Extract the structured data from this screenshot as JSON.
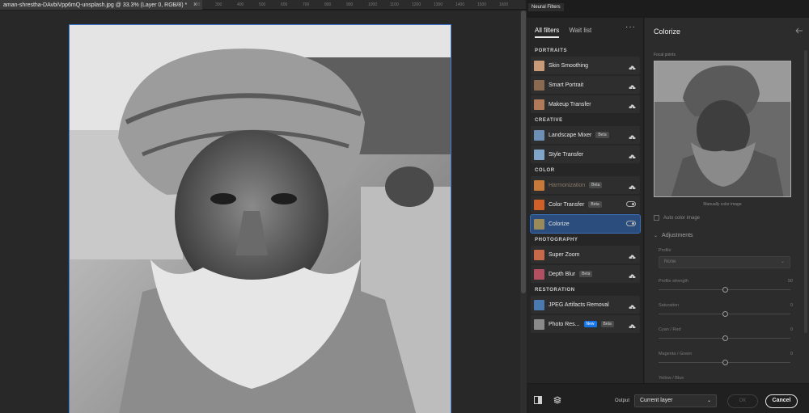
{
  "document": {
    "tab_title": "aman-shrestha-DAvbiVpp6mQ-unsplash.jpg @ 33.3% (Layer 0, RGB/8) *",
    "close_glyph": "×",
    "ruler_marks": [
      "100",
      "200",
      "300",
      "400",
      "500",
      "600",
      "700",
      "800",
      "900",
      "1000",
      "1100",
      "1200",
      "1300",
      "1400",
      "1500",
      "1600"
    ]
  },
  "neural_filters": {
    "window_title": "Neural Filters",
    "tabs": {
      "all": "All filters",
      "wait": "Wait list",
      "more": "···"
    },
    "sections": [
      {
        "label": "PORTRAITS",
        "filters": [
          {
            "name": "Skin Smoothing",
            "badge": "",
            "control": "cloud",
            "thumb": "#c89a78"
          },
          {
            "name": "Smart Portrait",
            "badge": "",
            "control": "cloud",
            "thumb": "#8a6b52"
          },
          {
            "name": "Makeup Transfer",
            "badge": "",
            "control": "cloud",
            "thumb": "#b37a5a"
          }
        ]
      },
      {
        "label": "CREATIVE",
        "filters": [
          {
            "name": "Landscape Mixer",
            "badge": "Beta",
            "control": "cloud",
            "thumb": "#6e8fb5"
          },
          {
            "name": "Style Transfer",
            "badge": "",
            "control": "cloud",
            "thumb": "#7fa6c8"
          }
        ]
      },
      {
        "label": "COLOR",
        "filters": [
          {
            "name": "Harmonization",
            "badge": "Beta",
            "control": "cloud",
            "thumb": "#c87a3a",
            "dim": true
          },
          {
            "name": "Color Transfer",
            "badge": "Beta",
            "control": "toggle",
            "thumb": "#d0602a"
          },
          {
            "name": "Colorize",
            "badge": "",
            "control": "toggle",
            "thumb": "#9a8a5a",
            "selected": true
          }
        ]
      },
      {
        "label": "PHOTOGRAPHY",
        "filters": [
          {
            "name": "Super Zoom",
            "badge": "",
            "control": "cloud",
            "thumb": "#c86a4a"
          },
          {
            "name": "Depth Blur",
            "badge": "Beta",
            "control": "cloud",
            "thumb": "#b05060"
          }
        ]
      },
      {
        "label": "RESTORATION",
        "filters": [
          {
            "name": "JPEG Artifacts Removal",
            "badge": "",
            "control": "cloud",
            "thumb": "#4a7ab0"
          },
          {
            "name": "Photo Res...",
            "badge": "New",
            "badge2": "Beta",
            "control": "cloud",
            "thumb": "#8a8a8a"
          }
        ]
      }
    ],
    "panel": {
      "title": "Colorize",
      "focal_points": "Focal points",
      "manual_label": "Manually color image",
      "auto_label": "Auto color image",
      "adjustments": "Adjustments",
      "chevron": "⌄",
      "profile_label": "Profile",
      "profile_value": "None",
      "controls": [
        {
          "label": "Profile strength",
          "value": "50",
          "pos": 0.5
        },
        {
          "label": "Saturation",
          "value": "0",
          "pos": 0.5
        },
        {
          "label": "Cyan / Red",
          "value": "0",
          "pos": 0.5
        },
        {
          "label": "Magenta / Green",
          "value": "0",
          "pos": 0.5
        },
        {
          "label": "Yellow / Blue",
          "value": "",
          "pos": null
        }
      ]
    },
    "footer": {
      "output_label": "Output",
      "output_value": "Current layer",
      "ok": "OK",
      "cancel": "Cancel"
    }
  }
}
